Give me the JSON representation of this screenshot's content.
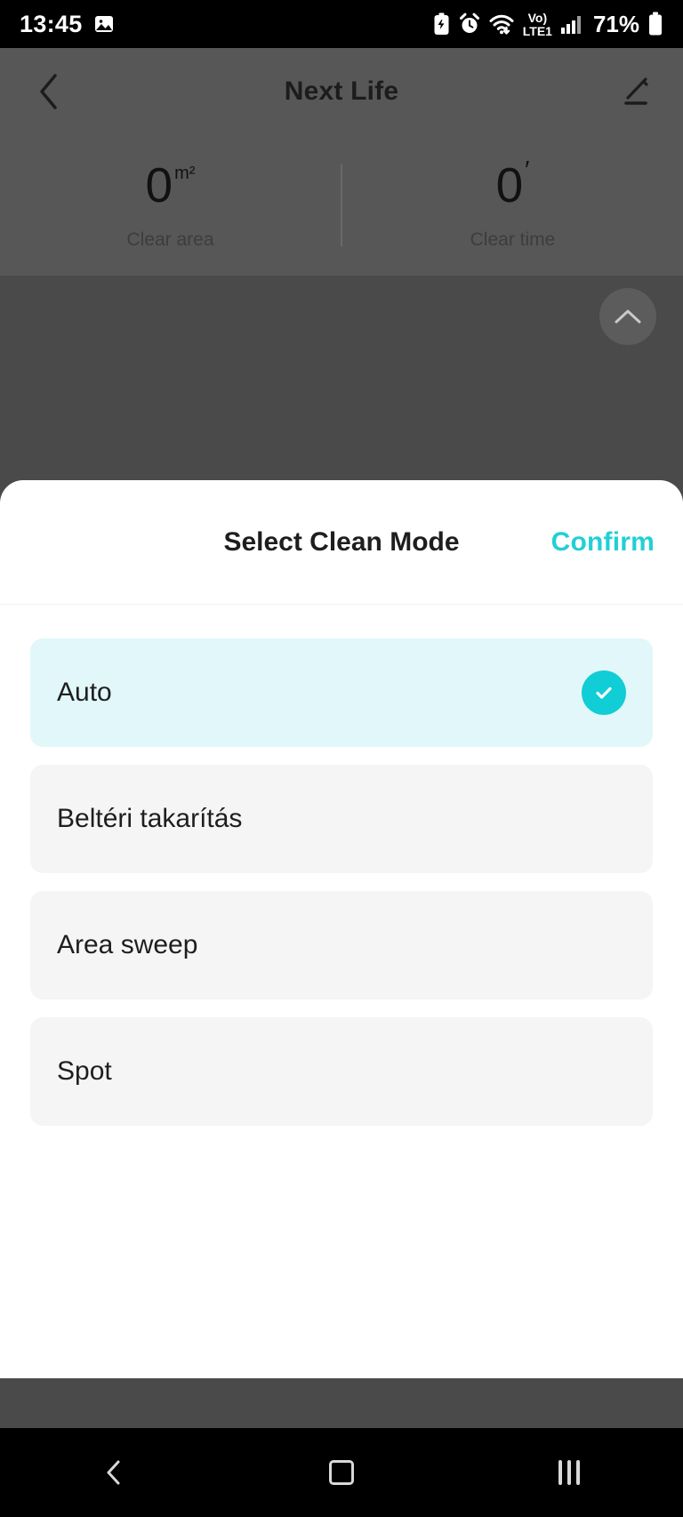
{
  "status_bar": {
    "time": "13:45",
    "battery_percent": "71%",
    "network_label": "LTE1",
    "volte_label": "Vo)",
    "icons": [
      "gallery-icon",
      "power-saving-icon",
      "alarm-icon",
      "wifi-icon",
      "volte-icon",
      "signal-icon",
      "battery-icon"
    ]
  },
  "header": {
    "title": "Next Life",
    "back_icon": "chevron-left-icon",
    "edit_icon": "pencil-icon"
  },
  "stats": [
    {
      "value": "0",
      "unit": "m²",
      "label": "Clear area"
    },
    {
      "value": "0",
      "unit": "′",
      "label": "Clear time"
    }
  ],
  "map": {
    "dock_icon": "charging-dock-icon",
    "expand_icon": "chevron-up-icon"
  },
  "sheet": {
    "title": "Select Clean Mode",
    "confirm_label": "Confirm",
    "options": [
      {
        "label": "Auto",
        "selected": true
      },
      {
        "label": "Beltéri takarítás",
        "selected": false
      },
      {
        "label": "Area sweep",
        "selected": false
      },
      {
        "label": "Spot",
        "selected": false
      }
    ]
  },
  "nav_bar": {
    "back_icon": "nav-back-icon",
    "home_icon": "nav-home-icon",
    "recents_icon": "nav-recents-icon"
  },
  "colors": {
    "accent": "#22cfd6",
    "selected_bg": "#e2f7f9",
    "option_bg": "#f5f5f5"
  }
}
